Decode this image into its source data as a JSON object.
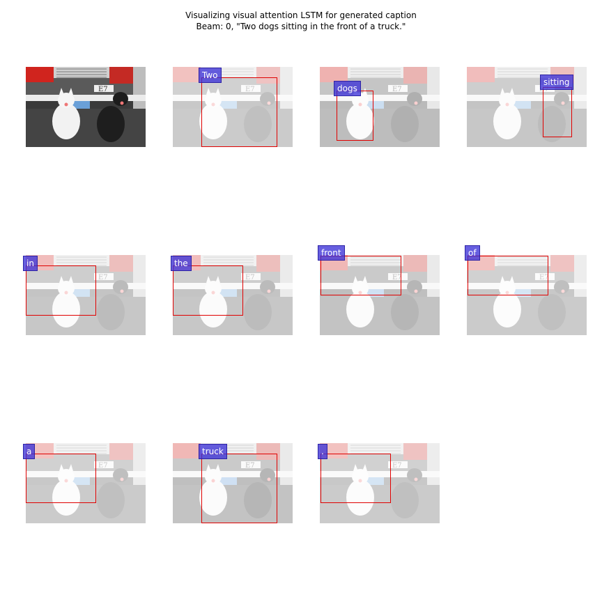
{
  "title": {
    "line1": "Visualizing visual attention LSTM for generated caption",
    "line2": "Beam: 0, \"Two dogs sitting in the front of a truck.\""
  },
  "words": [
    "Two",
    "dogs",
    "sitting",
    "in",
    "the",
    "front",
    "of",
    "a",
    "truck",
    "."
  ],
  "colors": {
    "box": "#e00000",
    "label_bg": "#3c32d7"
  }
}
